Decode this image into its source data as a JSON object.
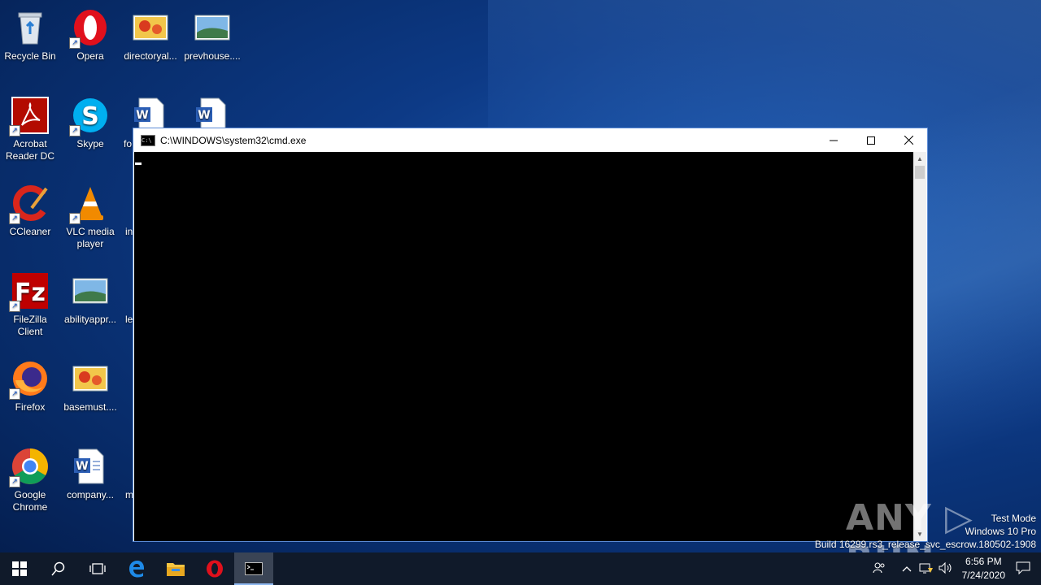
{
  "desktop": {
    "icons": [
      {
        "label": "Recycle Bin"
      },
      {
        "label": "Opera"
      },
      {
        "label": "directoryal..."
      },
      {
        "label": "prevhouse...."
      },
      {
        "label": "Acrobat Reader DC"
      },
      {
        "label": "Skype"
      },
      {
        "label": "fo"
      },
      {
        "label": "CCleaner"
      },
      {
        "label": "VLC media player"
      },
      {
        "label": "in"
      },
      {
        "label": "FileZilla Client"
      },
      {
        "label": "abilityappr..."
      },
      {
        "label": "le"
      },
      {
        "label": "Firefox"
      },
      {
        "label": "basemust...."
      },
      {
        "label": "Google Chrome"
      },
      {
        "label": "company..."
      },
      {
        "label": "m"
      }
    ]
  },
  "window": {
    "title": "C:\\WINDOWS\\system32\\cmd.exe",
    "icon": "cmd-icon",
    "minimize_glyph": "—",
    "maximize_glyph": "☐",
    "close_glyph": "✕"
  },
  "watermark": {
    "brand": "ANY ▷ RUN",
    "line1": "Test Mode",
    "line2": "Windows 10 Pro",
    "line3": "Build 16299.rs3_release_svc_escrow.180502-1908"
  },
  "taskbar": {
    "start_icon": "windows-logo-icon",
    "search_icon": "search-icon",
    "items": [
      "task-view-icon",
      "edge-icon",
      "file-explorer-icon",
      "opera-icon",
      "cmd-icon"
    ],
    "active_item": "cmd-icon"
  },
  "tray": {
    "time": "6:56 PM",
    "date": "7/24/2020",
    "icons": [
      "people-icon",
      "chevron-up-icon",
      "network-icon",
      "volume-icon",
      "notification-icon"
    ]
  },
  "colors": {
    "desktop_blue": "#0d3a86",
    "taskbar": "#101a2a",
    "window_border": "#5b8bd6",
    "console_bg": "#000000"
  }
}
